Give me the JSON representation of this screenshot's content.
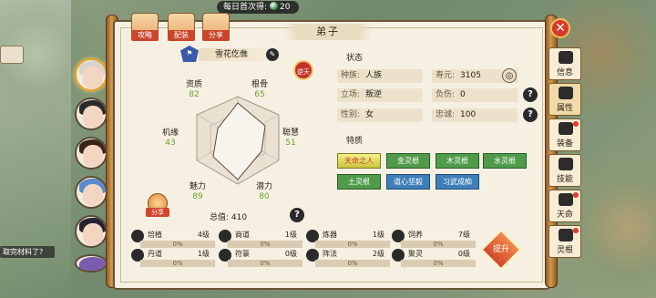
{
  "top_reward": {
    "label": "每日首次得:",
    "amount": "20"
  },
  "left_panel": {
    "button_label": "",
    "chat_text": "取完材料了?"
  },
  "top_tabs": [
    "攻略",
    "配装",
    "分享"
  ],
  "panel_title": "弟子",
  "character": {
    "name": "雪花仡僬",
    "seal": "逆天"
  },
  "radar": {
    "stats": [
      {
        "label": "资质",
        "value": "82"
      },
      {
        "label": "根骨",
        "value": "65"
      },
      {
        "label": "聪慧",
        "value": "51"
      },
      {
        "label": "潜力",
        "value": "80"
      },
      {
        "label": "魅力",
        "value": "89"
      },
      {
        "label": "机缘",
        "value": "43"
      }
    ],
    "total_label": "总值:",
    "total_value": "410",
    "share_label": "分享"
  },
  "status": {
    "title": "状态",
    "fields": {
      "race": {
        "key": "种族:",
        "value": "人族"
      },
      "lifespan": {
        "key": "寿元:",
        "value": "3105"
      },
      "stance": {
        "key": "立场:",
        "value": "叛逆"
      },
      "burden": {
        "key": "负伤:",
        "value": "0"
      },
      "gender": {
        "key": "性别:",
        "value": "女"
      },
      "loyalty": {
        "key": "忠诚:",
        "value": "100"
      }
    }
  },
  "traits": {
    "title": "特质",
    "items": [
      "天命之人",
      "金灵根",
      "木灵根",
      "水灵根",
      "土灵根",
      "道心坚毅",
      "习武成痴"
    ]
  },
  "skills": [
    {
      "name": "培植",
      "level": "4级",
      "progress": "0%"
    },
    {
      "name": "商道",
      "level": "1级",
      "progress": "0%"
    },
    {
      "name": "炼器",
      "level": "1级",
      "progress": "0%"
    },
    {
      "name": "饲养",
      "level": "7级",
      "progress": "0%"
    },
    {
      "name": "丹道",
      "level": "1级",
      "progress": "0%"
    },
    {
      "name": "符箓",
      "level": "0级",
      "progress": "0%"
    },
    {
      "name": "阵法",
      "level": "2级",
      "progress": "0%"
    },
    {
      "name": "聚灵",
      "level": "0级",
      "progress": "0%"
    }
  ],
  "upgrade_label": "提升",
  "right_tabs": [
    "信息",
    "属性",
    "装备",
    "技能",
    "天命",
    "灵根"
  ],
  "close_symbol": "✕",
  "help_symbol": "?"
}
